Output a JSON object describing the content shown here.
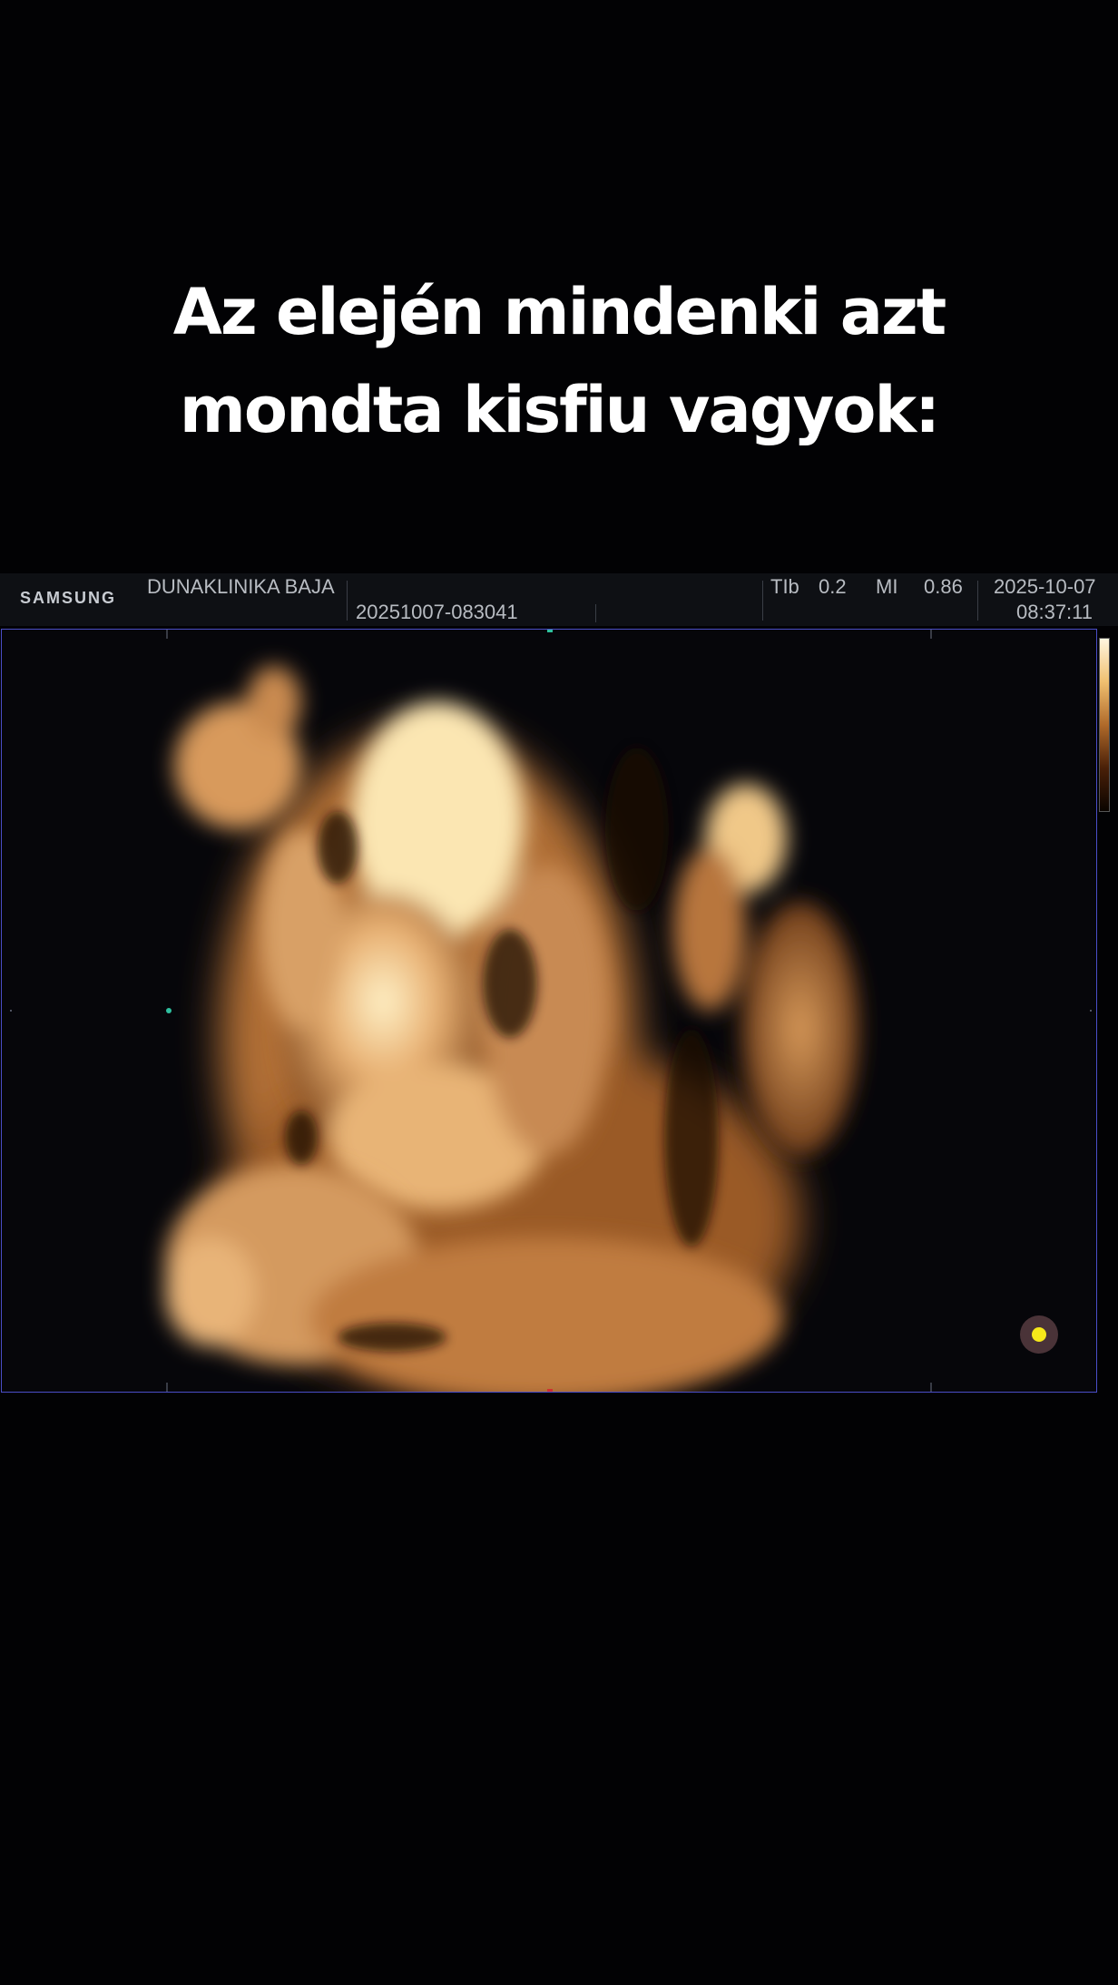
{
  "caption": {
    "line1": "Az elején mindenki azt",
    "line2": "mondta kisfiu vagyok:"
  },
  "ultrasound": {
    "brand": "SAMSUNG",
    "clinic": "DUNAKLINIKA BAJA",
    "study_id": "20251007-083041",
    "tib_label": "TIb",
    "tib_value": "0.2",
    "mi_label": "MI",
    "mi_value": "0.86",
    "date": "2025-10-07",
    "time": "08:37:11"
  },
  "colors": {
    "render_tone": "#e8b070",
    "frame_border": "#4a4ec8",
    "cursor": "#f6e81a"
  }
}
